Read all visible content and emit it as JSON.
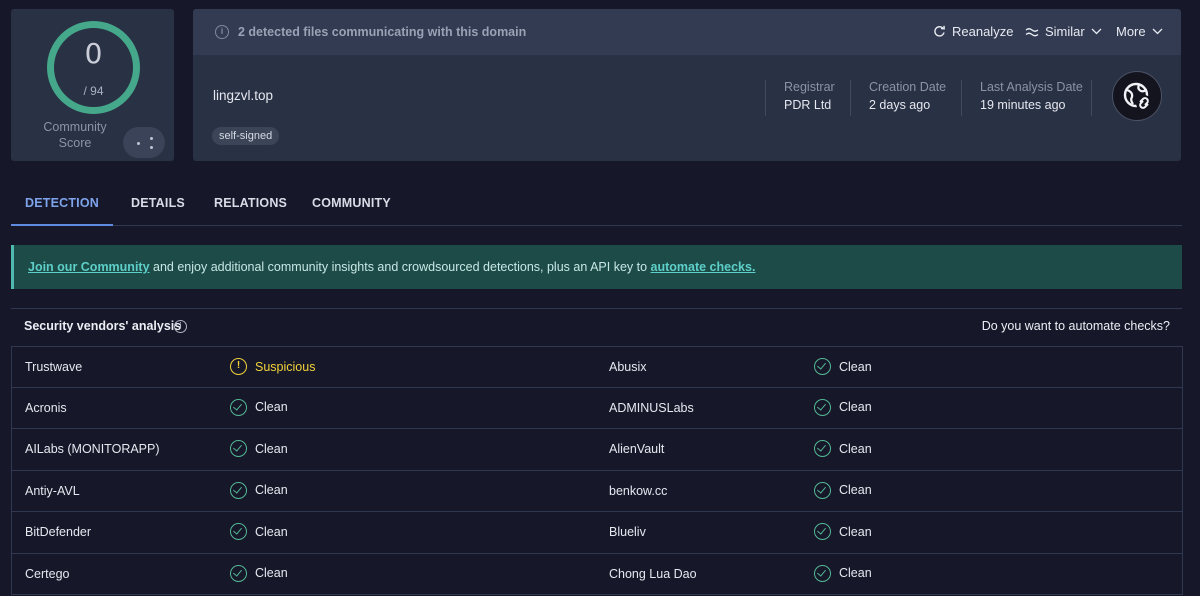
{
  "score": {
    "value": "0",
    "total": "/ 94",
    "community_label": "Community\nScore"
  },
  "header": {
    "detected_text": "2 detected files communicating with this domain",
    "actions": {
      "reanalyze": "Reanalyze",
      "similar": "Similar",
      "more": "More"
    },
    "domain": "lingzvl.top",
    "tag": "self-signed",
    "meta": [
      {
        "label": "Registrar",
        "value": "PDR Ltd"
      },
      {
        "label": "Creation Date",
        "value": "2 days ago"
      },
      {
        "label": "Last Analysis Date",
        "value": "19 minutes ago"
      }
    ]
  },
  "tabs": [
    "DETECTION",
    "DETAILS",
    "RELATIONS",
    "COMMUNITY"
  ],
  "banner": {
    "link1": "Join our Community",
    "middle": " and enjoy additional community insights and crowdsourced detections, plus an API key to ",
    "link2": "automate checks."
  },
  "vendors": {
    "title": "Security vendors' analysis",
    "automate": "Do you want to automate checks?",
    "rows": [
      {
        "left": {
          "name": "Trustwave",
          "result": "Suspicious",
          "status": "suspicious"
        },
        "right": {
          "name": "Abusix",
          "result": "Clean",
          "status": "clean"
        }
      },
      {
        "left": {
          "name": "Acronis",
          "result": "Clean",
          "status": "clean"
        },
        "right": {
          "name": "ADMINUSLabs",
          "result": "Clean",
          "status": "clean"
        }
      },
      {
        "left": {
          "name": "AILabs (MONITORAPP)",
          "result": "Clean",
          "status": "clean"
        },
        "right": {
          "name": "AlienVault",
          "result": "Clean",
          "status": "clean"
        }
      },
      {
        "left": {
          "name": "Antiy-AVL",
          "result": "Clean",
          "status": "clean"
        },
        "right": {
          "name": "benkow.cc",
          "result": "Clean",
          "status": "clean"
        }
      },
      {
        "left": {
          "name": "BitDefender",
          "result": "Clean",
          "status": "clean"
        },
        "right": {
          "name": "Blueliv",
          "result": "Clean",
          "status": "clean"
        }
      },
      {
        "left": {
          "name": "Certego",
          "result": "Clean",
          "status": "clean"
        },
        "right": {
          "name": "Chong Lua Dao",
          "result": "Clean",
          "status": "clean"
        }
      }
    ]
  },
  "colors": {
    "accent": "#5f8ce0",
    "clean": "#54b894",
    "suspicious": "#f0d23a",
    "ring": "#45a88a",
    "banner": "#1c4b48"
  }
}
